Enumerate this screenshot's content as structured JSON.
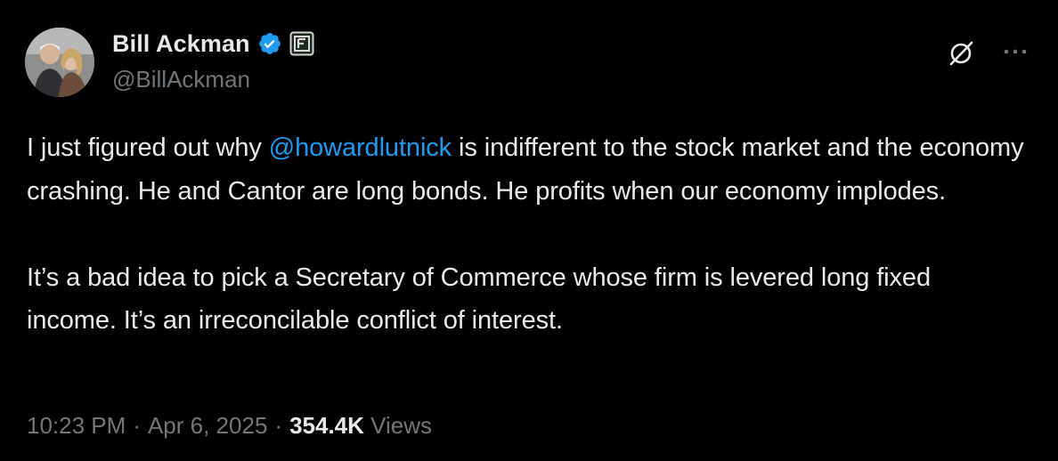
{
  "author": {
    "display_name": "Bill Ackman",
    "handle": "@BillAckman",
    "verified": true,
    "affiliation_badge": "square-logo-icon",
    "avatar": "profile-photo"
  },
  "actions": {
    "grok_icon": "grok-slash-circle-icon",
    "more_icon": "ellipsis-icon"
  },
  "tweet": {
    "line1_before": "I just figured out why ",
    "mention": "@howardlutnick",
    "line1_after": " is indifferent to the stock market and the economy crashing. He and Cantor are long bonds. He profits when our economy implodes.",
    "paragraph2": "It’s a bad idea to pick a Secretary of Commerce whose firm is levered long fixed income. It’s an irreconcilable conflict of interest."
  },
  "meta": {
    "time": "10:23 PM",
    "separator": "·",
    "date": "Apr 6, 2025",
    "views_count": "354.4K",
    "views_label": "Views"
  },
  "colors": {
    "background": "#000000",
    "text": "#e7e9ea",
    "secondary_text": "#71767b",
    "link": "#1d9bf0",
    "verified_badge": "#1d9bf0"
  }
}
